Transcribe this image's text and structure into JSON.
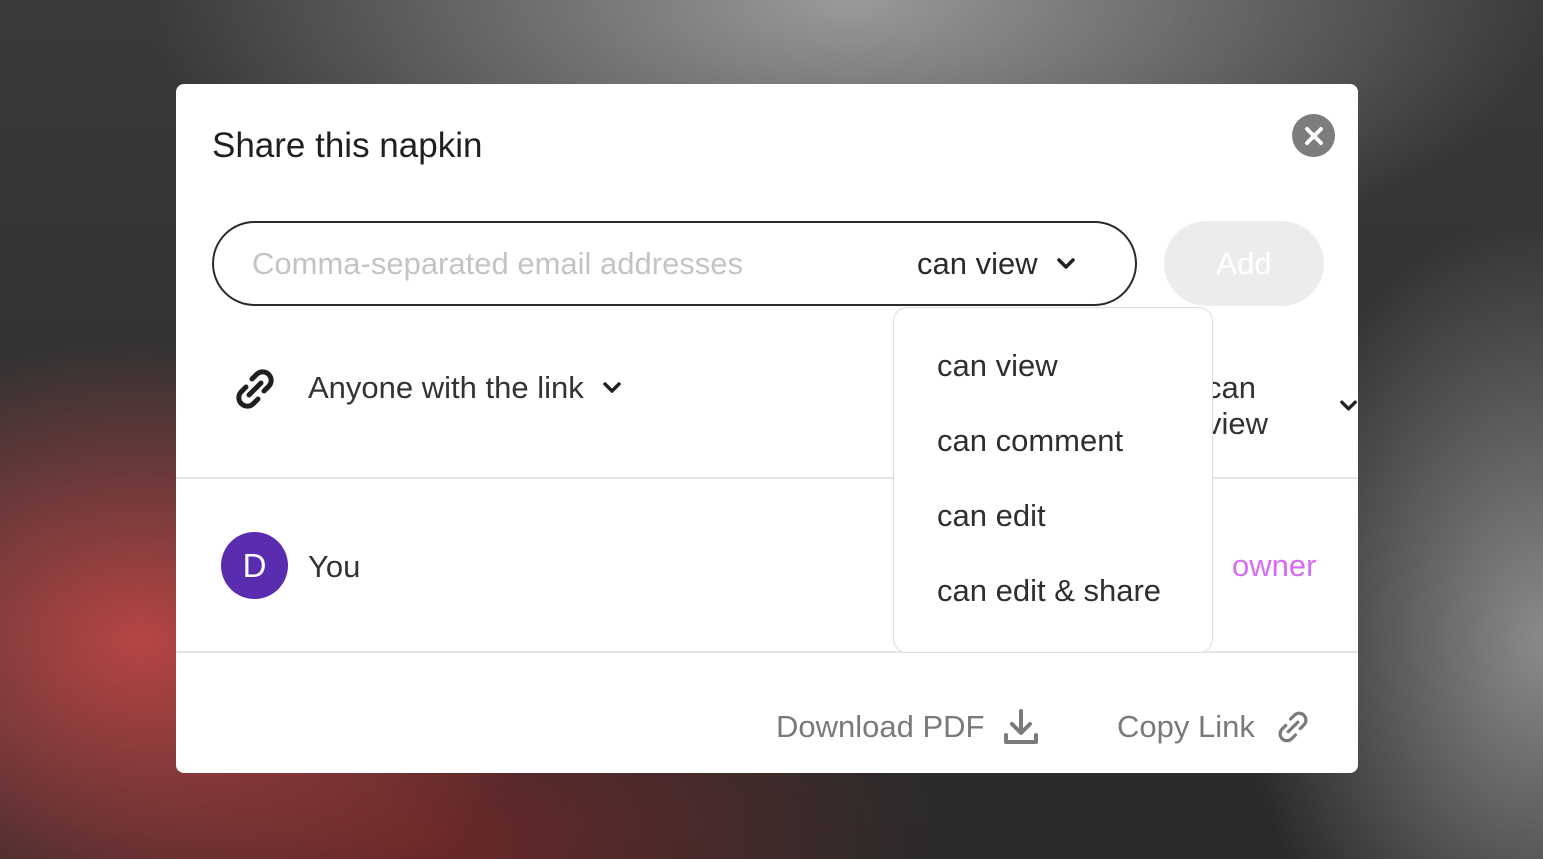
{
  "dialog": {
    "title": "Share this napkin"
  },
  "invite": {
    "email_placeholder": "Comma-separated email addresses",
    "email_value": "",
    "permission_selected": "can view",
    "add_label": "Add"
  },
  "link_sharing": {
    "scope_label": "Anyone with the link",
    "permission_label": "can view"
  },
  "permission_menu": {
    "options": [
      "can view",
      "can comment",
      "can edit",
      "can edit & share"
    ]
  },
  "members": [
    {
      "initial": "D",
      "name": "You",
      "role": "owner"
    }
  ],
  "footer": {
    "download_label": "Download PDF",
    "copy_link_label": "Copy Link"
  },
  "colors": {
    "avatar": "#5a2db0",
    "owner_role": "#d86bf5",
    "close_button": "#7d7d7d"
  },
  "icons": {
    "close": "close-icon",
    "chevron": "chevron-down-icon",
    "link": "link-icon",
    "download": "download-icon"
  }
}
